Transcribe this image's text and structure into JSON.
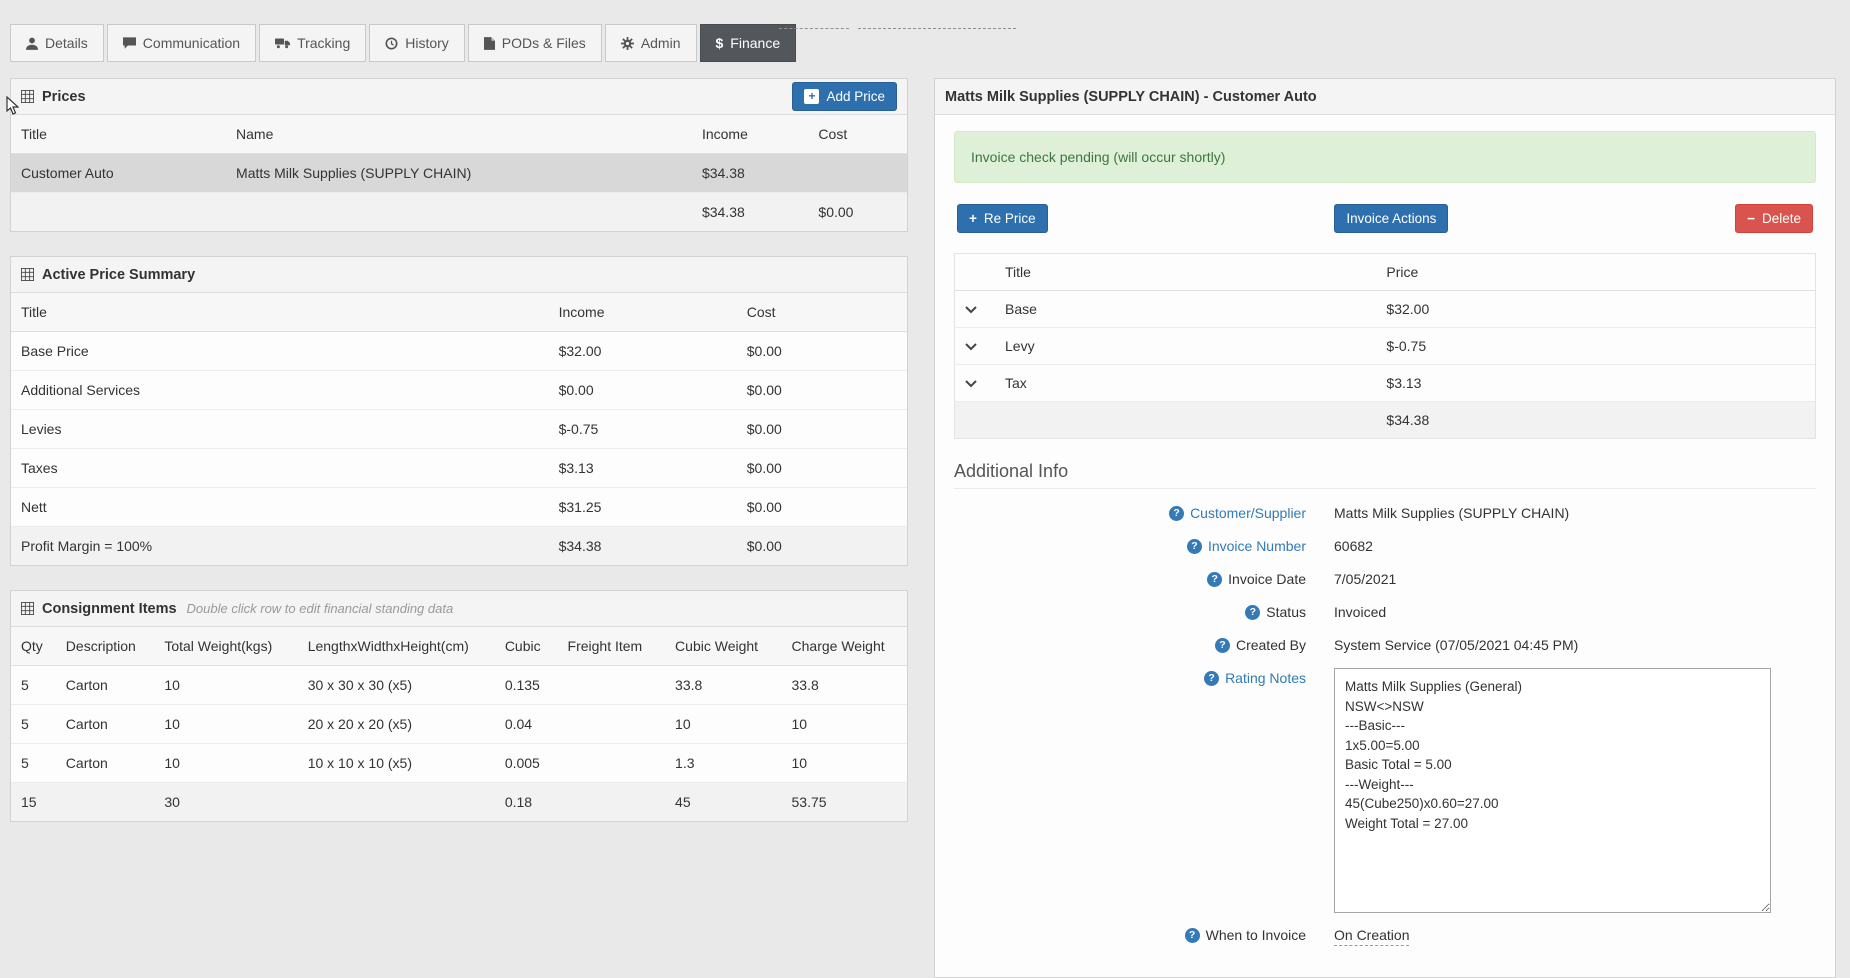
{
  "icons": {
    "question": "?",
    "plus": "+",
    "minus": "−",
    "dollar": "$"
  },
  "tabs": {
    "details": "Details",
    "communication": "Communication",
    "tracking": "Tracking",
    "history": "History",
    "pods": "PODs & Files",
    "admin": "Admin",
    "finance": "Finance"
  },
  "prices": {
    "title": "Prices",
    "add_button": "Add Price",
    "columns": {
      "title": "Title",
      "name": "Name",
      "income": "Income",
      "cost": "Cost"
    },
    "rows": [
      {
        "title": "Customer Auto",
        "name": "Matts Milk Supplies (SUPPLY CHAIN)",
        "income": "$34.38",
        "cost": ""
      }
    ],
    "total_income": "$34.38",
    "total_cost": "$0.00"
  },
  "summary": {
    "title": "Active Price Summary",
    "columns": {
      "title": "Title",
      "income": "Income",
      "cost": "Cost"
    },
    "rows": [
      {
        "title": "Base Price",
        "income": "$32.00",
        "cost": "$0.00"
      },
      {
        "title": "Additional Services",
        "income": "$0.00",
        "cost": "$0.00"
      },
      {
        "title": "Levies",
        "income": "$-0.75",
        "cost": "$0.00"
      },
      {
        "title": "Taxes",
        "income": "$3.13",
        "cost": "$0.00"
      },
      {
        "title": "Nett",
        "income": "$31.25",
        "cost": "$0.00"
      },
      {
        "title": "Profit Margin = 100%",
        "income": "$34.38",
        "cost": "$0.00"
      }
    ]
  },
  "consignment": {
    "title": "Consignment Items",
    "subtitle": "Double click row to edit financial standing data",
    "columns": [
      "Qty",
      "Description",
      "Total Weight(kgs)",
      "LengthxWidthxHeight(cm)",
      "Cubic",
      "Freight Item",
      "Cubic Weight",
      "Charge Weight"
    ],
    "rows": [
      [
        "5",
        "Carton",
        "10",
        "30 x 30 x 30 (x5)",
        "0.135",
        "",
        "33.8",
        "33.8"
      ],
      [
        "5",
        "Carton",
        "10",
        "20 x 20 x 20 (x5)",
        "0.04",
        "",
        "10",
        "10"
      ],
      [
        "5",
        "Carton",
        "10",
        "10 x 10 x 10 (x5)",
        "0.005",
        "",
        "1.3",
        "10"
      ]
    ],
    "totals": [
      "15",
      "",
      "30",
      "",
      "0.18",
      "",
      "45",
      "53.75"
    ]
  },
  "invoice": {
    "title": "Matts Milk Supplies (SUPPLY CHAIN) - Customer Auto",
    "alert": "Invoice check pending (will occur shortly)",
    "re_price_button": "Re Price",
    "invoice_actions_button": "Invoice Actions",
    "delete_button": "Delete",
    "price_columns": {
      "title": "Title",
      "price": "Price"
    },
    "price_rows": [
      {
        "title": "Base",
        "price": "$32.00"
      },
      {
        "title": "Levy",
        "price": "$-0.75"
      },
      {
        "title": "Tax",
        "price": "$3.13"
      }
    ],
    "price_total": "$34.38",
    "additional_info": {
      "heading": "Additional Info",
      "customer_supplier_label": "Customer/Supplier",
      "customer_supplier_value": "Matts Milk Supplies (SUPPLY CHAIN)",
      "invoice_number_label": "Invoice Number",
      "invoice_number_value": "60682",
      "invoice_date_label": "Invoice Date",
      "invoice_date_value": "7/05/2021",
      "status_label": "Status",
      "status_value": "Invoiced",
      "created_by_label": "Created By",
      "created_by_value": "System Service (07/05/2021 04:45 PM)",
      "rating_notes_label": "Rating Notes",
      "rating_notes_value": "Matts Milk Supplies (General)\nNSW<>NSW\n---Basic---\n1x5.00=5.00\nBasic Total = 5.00\n---Weight---\n45(Cube250)x0.60=27.00\nWeight Total = 27.00",
      "when_to_invoice_label": "When to Invoice",
      "when_to_invoice_value": "On Creation"
    }
  }
}
